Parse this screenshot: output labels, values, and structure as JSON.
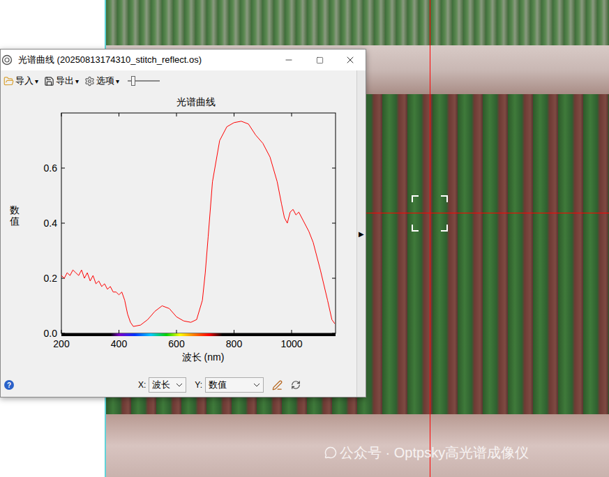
{
  "window": {
    "title": "光谱曲线 (20250813174310_stitch_reflect.os)"
  },
  "toolbar": {
    "items": [
      {
        "label": "导入",
        "arrow": "▾"
      },
      {
        "label": "导出",
        "arrow": "▾"
      },
      {
        "label": "选项",
        "arrow": "▾"
      }
    ],
    "slider": {
      "level": 0.12
    }
  },
  "chart": {
    "title": "光谱曲线",
    "y_label": "数值",
    "x_label": "波长 (nm)",
    "y_ticks": [
      "0.0",
      "0.2",
      "0.4",
      "0.6"
    ],
    "x_ticks": [
      "200",
      "400",
      "600",
      "800",
      "1000"
    ],
    "series": [
      {
        "x": [
          200,
          210,
          220,
          230,
          240,
          250,
          260,
          270,
          280,
          290,
          300,
          310,
          320,
          330,
          340,
          350,
          360,
          370,
          380,
          390,
          400,
          410,
          420,
          430,
          440,
          450,
          475,
          500,
          525,
          550,
          575,
          600,
          625,
          650,
          670,
          690,
          700,
          710,
          725,
          750,
          775,
          800,
          825,
          850,
          875,
          900,
          925,
          950,
          965,
          975,
          985,
          995,
          1005,
          1015,
          1025,
          1040,
          1060,
          1075,
          1100,
          1125,
          1140,
          1150
        ],
        "y": [
          0.21,
          0.2,
          0.22,
          0.21,
          0.23,
          0.22,
          0.21,
          0.23,
          0.2,
          0.22,
          0.19,
          0.21,
          0.18,
          0.19,
          0.17,
          0.18,
          0.16,
          0.17,
          0.15,
          0.15,
          0.14,
          0.15,
          0.12,
          0.07,
          0.04,
          0.025,
          0.03,
          0.05,
          0.08,
          0.1,
          0.09,
          0.06,
          0.045,
          0.04,
          0.05,
          0.12,
          0.22,
          0.35,
          0.55,
          0.7,
          0.75,
          0.765,
          0.77,
          0.76,
          0.72,
          0.69,
          0.64,
          0.55,
          0.47,
          0.42,
          0.4,
          0.44,
          0.45,
          0.43,
          0.44,
          0.41,
          0.37,
          0.33,
          0.23,
          0.12,
          0.05,
          0.035
        ]
      }
    ]
  },
  "bottom_bar": {
    "help": "?",
    "x_axis": {
      "label": "X:",
      "value": "波长"
    },
    "y_axis": {
      "label": "Y:",
      "value": "数值"
    }
  },
  "splitter": {
    "arrow": "▶"
  },
  "watermark": {
    "text": "公众号 · Optpsky高光谱成像仪"
  }
}
